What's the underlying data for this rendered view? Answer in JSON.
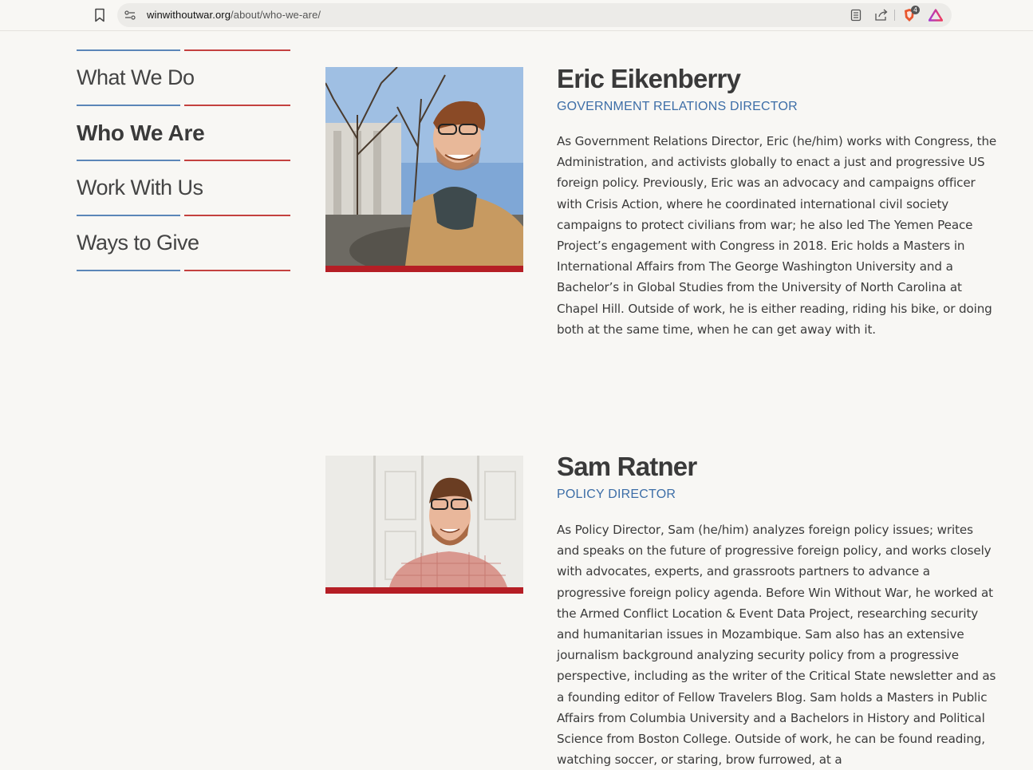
{
  "browser": {
    "url_host": "winwithoutwar.org",
    "url_path": "/about/who-we-are/",
    "brave_badge_count": "4"
  },
  "sidenav": {
    "items": [
      {
        "label": "What We Do",
        "active": false
      },
      {
        "label": "Who We Are",
        "active": true
      },
      {
        "label": "Work With Us",
        "active": false
      },
      {
        "label": "Ways to Give",
        "active": false
      }
    ]
  },
  "staff": [
    {
      "name": "Eric Eikenberry",
      "role": "GOVERNMENT RELATIONS DIRECTOR",
      "bio": "As Government Relations Director, Eric (he/him) works with Congress, the Administration, and activists globally to enact a just and progressive US foreign policy. Previously, Eric was an advocacy and campaigns officer with Crisis Action, where he coordinated international civil society campaigns to protect civilians from war; he also led The Yemen Peace Project’s engagement with Congress in 2018. Eric holds a Masters in International Affairs from The George Washington University and a Bachelor’s in Global Studies from the University of North Carolina at Chapel Hill. Outside of work, he is either reading, riding his bike, or doing both at the same time, when he can get away with it."
    },
    {
      "name": "Sam Ratner",
      "role": "POLICY DIRECTOR",
      "bio": "As Policy Director, Sam (he/him) analyzes foreign policy issues; writes and speaks on the future of progressive foreign policy, and works closely with advocates, experts, and grassroots partners to advance a progressive foreign policy agenda. Before Win Without War, he worked at the Armed Conflict Location & Event Data Project, researching security and humanitarian issues in Mozambique. Sam also has an extensive journalism background analyzing security policy from a progressive perspective, including as the writer of the Critical State newsletter and as a founding editor of Fellow Travelers Blog. Sam holds a Masters in Public Affairs from Columbia University and a Bachelors in History and Political Science from Boston College. Outside of work, he can be found reading, watching soccer, or staring, brow furrowed, at a"
    }
  ],
  "colors": {
    "accent_blue": "#5b86b8",
    "accent_red": "#c4413f",
    "photo_bar": "#b51e25",
    "role_text": "#3d6ea7"
  }
}
